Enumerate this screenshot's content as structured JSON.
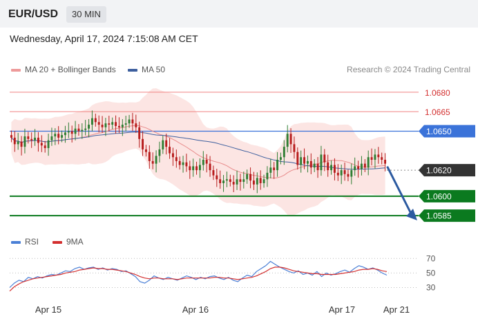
{
  "header": {
    "pair": "EUR/USD",
    "timeframe": "30 MIN",
    "datetime": "Wednesday, April 17, 2024 7:15:08 AM CET"
  },
  "legend": {
    "ma20_label": "MA 20 + Bollinger Bands",
    "ma50_label": "MA 50",
    "credit": "Research © 2024 Trading Central",
    "rsi_label": "RSI",
    "rsi9_label": "9MA"
  },
  "colors": {
    "ma20": "#e88b8b",
    "bands_fill": "#fbe0de",
    "ma50": "#3d5f9e",
    "candle_up": "#2e7d32",
    "candle_down": "#b71c1c",
    "support": "#0b7a1f",
    "resistance": "#f08080",
    "pivot": "#3b73d9",
    "last_price_box": "#333333",
    "arrow": "#2c5aa0",
    "rsi": "#4a7fd6",
    "rsi_ma": "#d32f2f"
  },
  "chart_data": {
    "type": "candlestick",
    "ylim": [
      1.0575,
      1.069
    ],
    "x_labels": [
      "Apr 15",
      "Apr 16",
      "Apr 17",
      "Apr 21"
    ],
    "levels": [
      {
        "value": 1.068,
        "label": "1.0680",
        "kind": "resistance"
      },
      {
        "value": 1.0665,
        "label": "1.0665",
        "kind": "resistance"
      },
      {
        "value": 1.065,
        "label": "1.0650",
        "kind": "pivot"
      },
      {
        "value": 1.062,
        "label": "1.0620",
        "kind": "last"
      },
      {
        "value": 1.06,
        "label": "1.0600",
        "kind": "support"
      },
      {
        "value": 1.0585,
        "label": "1.0585",
        "kind": "support"
      }
    ],
    "close": [
      1.0645,
      1.064,
      1.0642,
      1.0638,
      1.0646,
      1.0644,
      1.0643,
      1.0645,
      1.0641,
      1.0639,
      1.0637,
      1.0643,
      1.0646,
      1.0648,
      1.0645,
      1.0647,
      1.0649,
      1.065,
      1.0648,
      1.0652,
      1.065,
      1.0651,
      1.0652,
      1.0655,
      1.066,
      1.0657,
      1.0655,
      1.0653,
      1.0656,
      1.0655,
      1.0657,
      1.0654,
      1.0653,
      1.0655,
      1.0656,
      1.0659,
      1.0656,
      1.0653,
      1.0644,
      1.0636,
      1.0634,
      1.0627,
      1.0625,
      1.0631,
      1.0636,
      1.0643,
      1.0638,
      1.0633,
      1.063,
      1.0627,
      1.0624,
      1.0626,
      1.0623,
      1.062,
      1.0623,
      1.062,
      1.0624,
      1.0628,
      1.0625,
      1.062,
      1.0616,
      1.0613,
      1.061,
      1.0612,
      1.0613,
      1.0611,
      1.0609,
      1.0613,
      1.0611,
      1.0613,
      1.0617,
      1.0612,
      1.0609,
      1.0614,
      1.061,
      1.0613,
      1.0618,
      1.0622,
      1.062,
      1.0628,
      1.063,
      1.0638,
      1.0648,
      1.064,
      1.0634,
      1.0624,
      1.063,
      1.0625,
      1.0627,
      1.0622,
      1.0625,
      1.062,
      1.0632,
      1.0626,
      1.062,
      1.0624,
      1.0618,
      1.0616,
      1.062,
      1.0617,
      1.0615,
      1.062,
      1.0623,
      1.0621,
      1.0625,
      1.0622,
      1.063,
      1.0628,
      1.0632,
      1.063,
      1.0628,
      1.0625
    ],
    "rsi": {
      "ylim": [
        20,
        75
      ],
      "ticks": [
        "70",
        "50",
        "30"
      ],
      "rsi": [
        30,
        36,
        40,
        38,
        44,
        42,
        45,
        43,
        46,
        48,
        47,
        50,
        53,
        52,
        56,
        58,
        55,
        57,
        58,
        55,
        57,
        54,
        56,
        55,
        52,
        53,
        49,
        45,
        38,
        36,
        40,
        46,
        43,
        41,
        44,
        42,
        40,
        43,
        46,
        44,
        41,
        44,
        42,
        45,
        46,
        43,
        41,
        44,
        40,
        38,
        43,
        47,
        45,
        52,
        56,
        60,
        66,
        62,
        58,
        55,
        52,
        50,
        53,
        48,
        50,
        47,
        52,
        45,
        50,
        47,
        49,
        52,
        54,
        51,
        56,
        60,
        58,
        55,
        57,
        54,
        50,
        47
      ],
      "rsi_ma": [
        25,
        31,
        35,
        38,
        40,
        42,
        43,
        44,
        45,
        46,
        47,
        48,
        50,
        51,
        52,
        54,
        55,
        56,
        57,
        56,
        56,
        55,
        55,
        54,
        53,
        52,
        50,
        48,
        45,
        43,
        42,
        43,
        43,
        42,
        42,
        42,
        41,
        42,
        43,
        43,
        43,
        43,
        43,
        43,
        44,
        44,
        43,
        43,
        42,
        41,
        42,
        43,
        44,
        46,
        49,
        52,
        56,
        58,
        58,
        57,
        55,
        53,
        52,
        51,
        50,
        49,
        49,
        48,
        48,
        48,
        48,
        49,
        50,
        51,
        52,
        54,
        55,
        55,
        56,
        55,
        53,
        52
      ]
    }
  }
}
